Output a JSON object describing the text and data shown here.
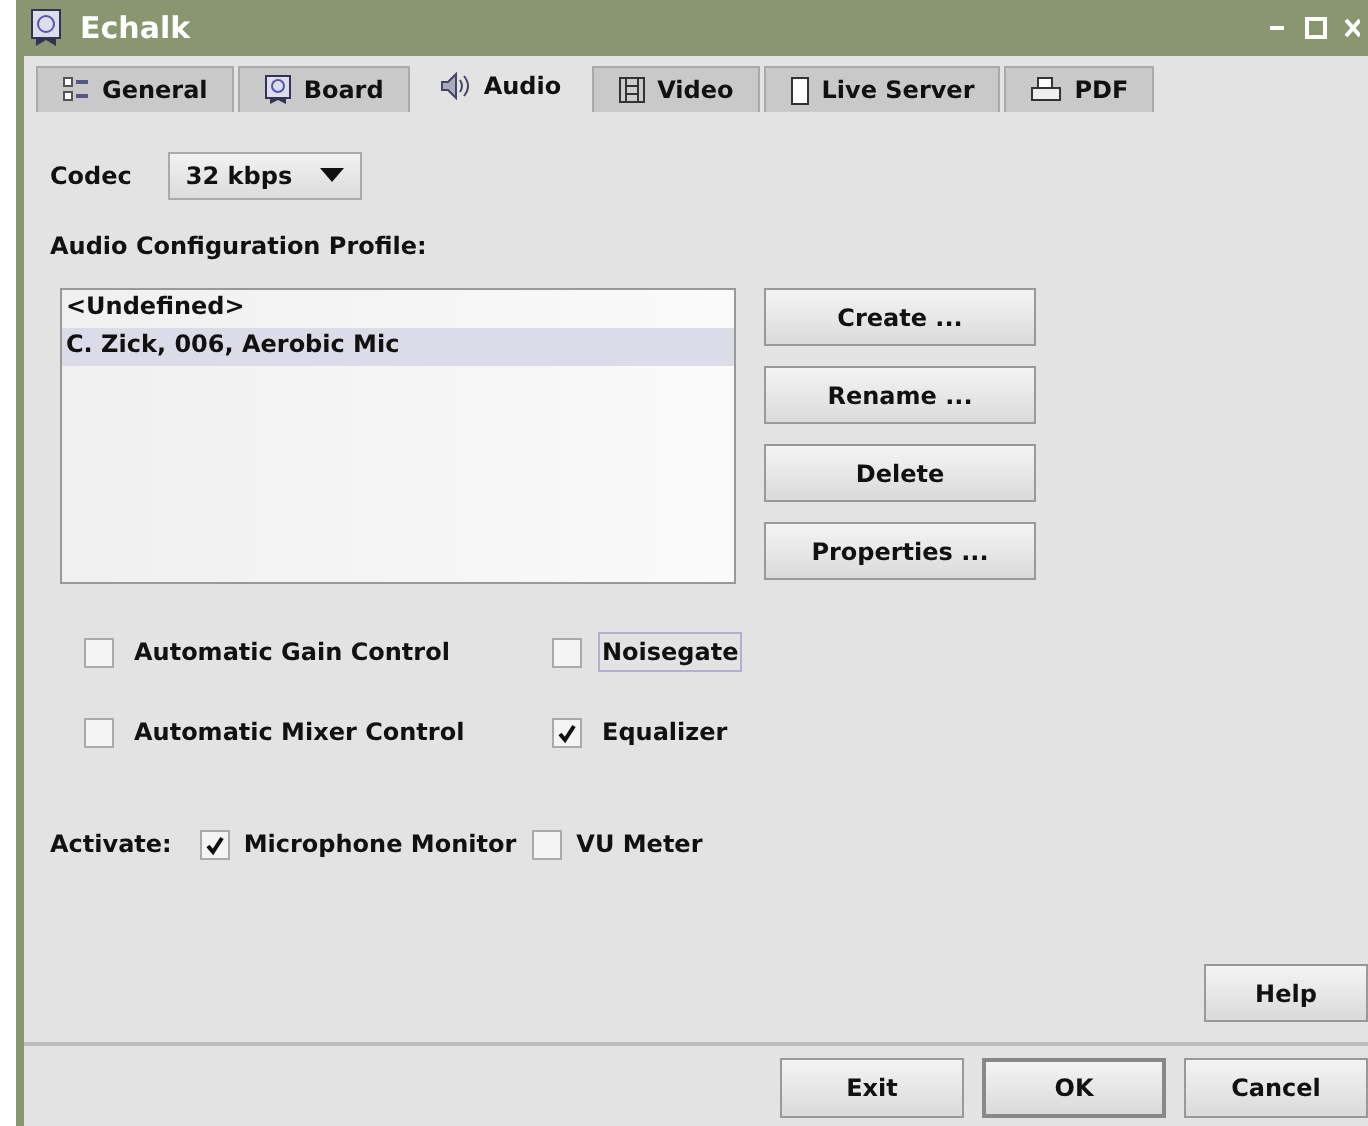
{
  "window": {
    "title": "Echalk"
  },
  "tabs": [
    {
      "label": "General",
      "kind": "list",
      "selected": false
    },
    {
      "label": "Board",
      "kind": "board",
      "selected": false
    },
    {
      "label": "Audio",
      "kind": "speaker",
      "selected": true
    },
    {
      "label": "Video",
      "kind": "film",
      "selected": false
    },
    {
      "label": "Live Server",
      "kind": "phone",
      "selected": false
    },
    {
      "label": "PDF",
      "kind": "printer",
      "selected": false
    }
  ],
  "codec": {
    "label": "Codec",
    "value": "32 kbps"
  },
  "profile": {
    "label": "Audio Configuration Profile:",
    "items": [
      {
        "text": "<Undefined>",
        "selected": false
      },
      {
        "text": "C. Zick, 006, Aerobic Mic",
        "selected": true
      }
    ],
    "buttons": [
      "Create ...",
      "Rename ...",
      "Delete",
      "Properties ..."
    ]
  },
  "options": [
    [
      {
        "label": "Automatic Gain Control",
        "checked": false,
        "focused": false
      },
      {
        "label": "Noisegate",
        "checked": false,
        "focused": true
      }
    ],
    [
      {
        "label": "Automatic Mixer Control",
        "checked": false,
        "focused": false
      },
      {
        "label": "Equalizer",
        "checked": true,
        "focused": false
      }
    ]
  ],
  "activate": {
    "label": "Activate:",
    "items": [
      {
        "label": "Microphone Monitor",
        "checked": true
      },
      {
        "label": "VU Meter",
        "checked": false
      }
    ]
  },
  "help_button": "Help",
  "footer_buttons": [
    {
      "label": "Exit",
      "default": false
    },
    {
      "label": "OK",
      "default": true
    },
    {
      "label": "Cancel",
      "default": false
    }
  ]
}
